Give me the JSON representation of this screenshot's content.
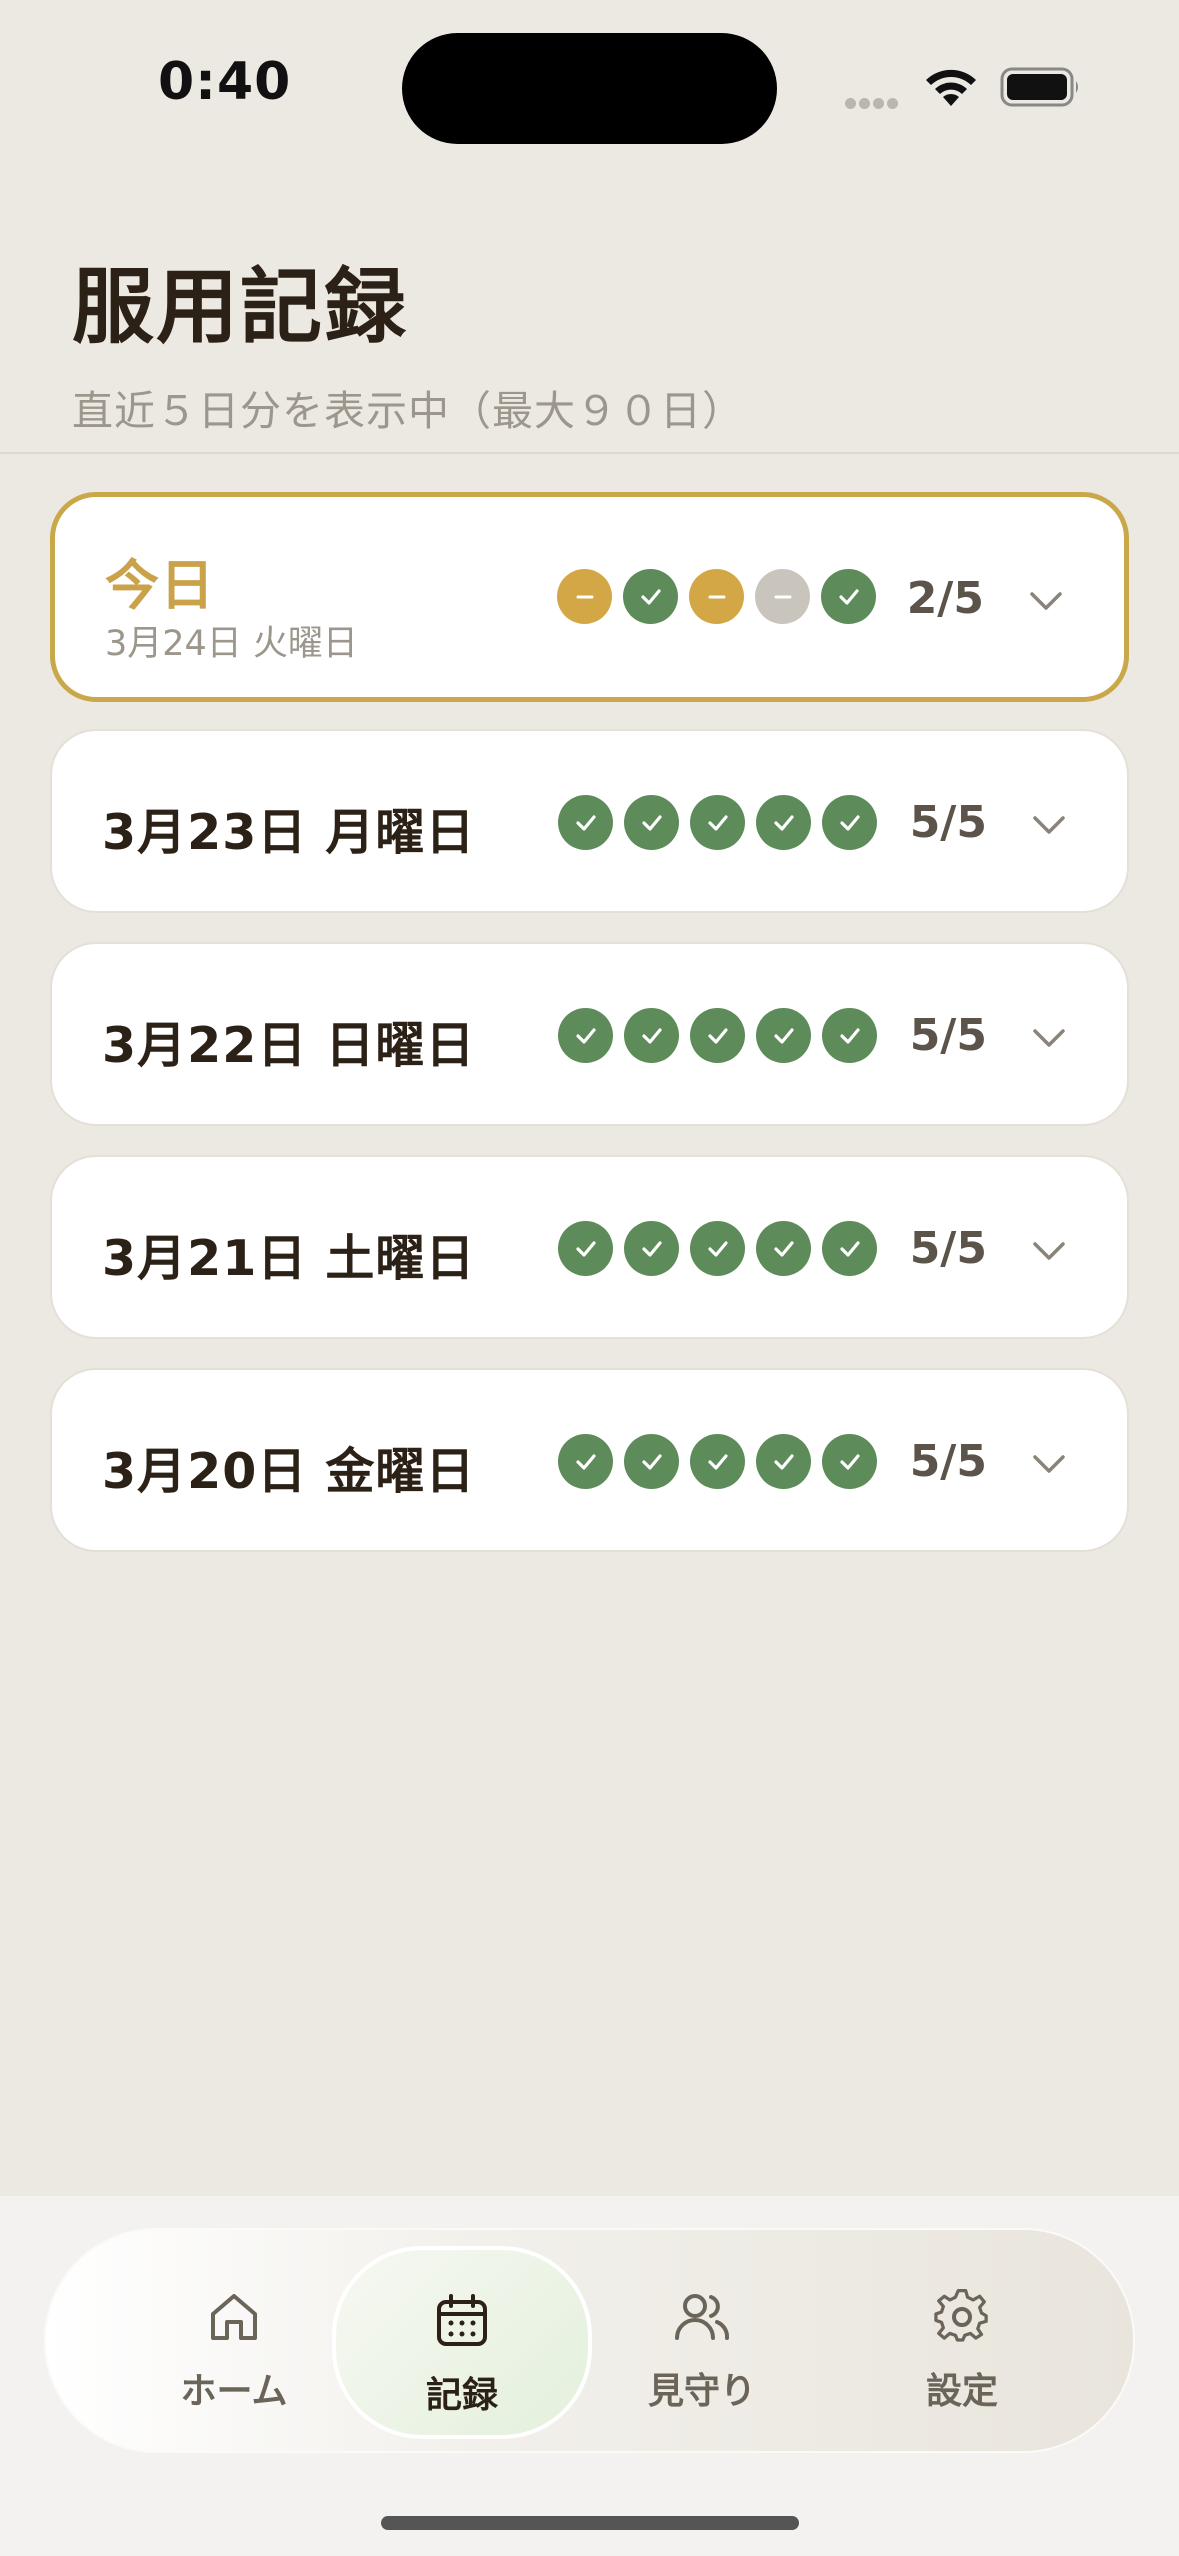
{
  "status_bar": {
    "time": "0:40"
  },
  "header": {
    "title": "服用記録",
    "subtitle": "直近５日分を表示中（最大９０日）"
  },
  "days": [
    {
      "label": "今日",
      "sublabel": "3月24日 火曜日",
      "count": "2/5",
      "today": true,
      "doses": [
        "skipped",
        "taken",
        "skipped",
        "pending",
        "taken"
      ]
    },
    {
      "label": "3月23日 月曜日",
      "count": "5/5",
      "doses": [
        "taken",
        "taken",
        "taken",
        "taken",
        "taken"
      ]
    },
    {
      "label": "3月22日 日曜日",
      "count": "5/5",
      "doses": [
        "taken",
        "taken",
        "taken",
        "taken",
        "taken"
      ]
    },
    {
      "label": "3月21日 土曜日",
      "count": "5/5",
      "doses": [
        "taken",
        "taken",
        "taken",
        "taken",
        "taken"
      ]
    },
    {
      "label": "3月20日 金曜日",
      "count": "5/5",
      "doses": [
        "taken",
        "taken",
        "taken",
        "taken",
        "taken"
      ]
    }
  ],
  "tabbar": {
    "tabs": [
      {
        "label": "ホーム",
        "icon": "home-icon",
        "active": false
      },
      {
        "label": "記録",
        "icon": "calendar-icon",
        "active": true
      },
      {
        "label": "見守り",
        "icon": "people-icon",
        "active": false
      },
      {
        "label": "設定",
        "icon": "gear-icon",
        "active": false
      }
    ]
  },
  "colors": {
    "taken": "#5E8B5A",
    "skipped": "#D4A746",
    "pending": "#C9C4BC",
    "today_accent": "#C9A24A",
    "background": "#ECE9E2"
  }
}
